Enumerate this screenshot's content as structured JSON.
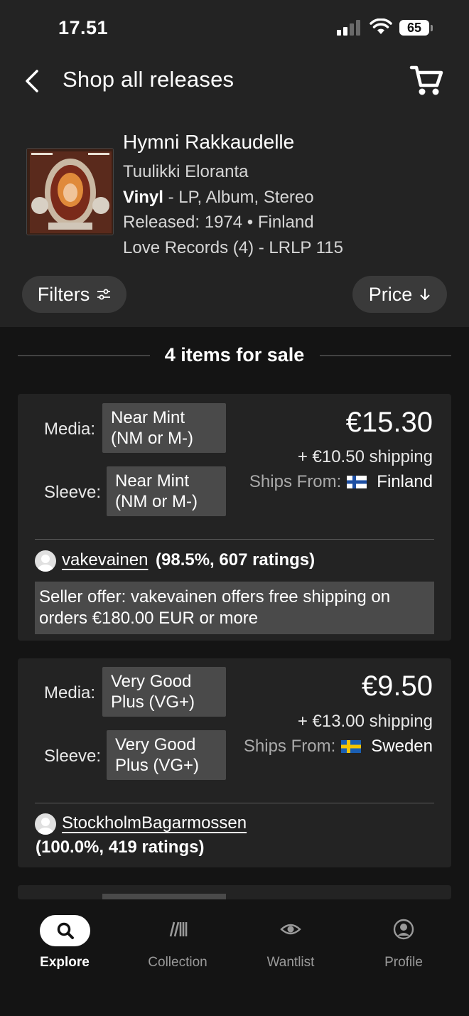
{
  "status_bar": {
    "time": "17.51",
    "battery": "65"
  },
  "header": {
    "title": "Shop all releases"
  },
  "release": {
    "title": "Hymni Rakkaudelle",
    "artist": "Tuulikki Eloranta",
    "format_bold": "Vinyl",
    "format_rest": " - LP, Album, Stereo",
    "released": "Released: 1974 • Finland",
    "label": "Love Records (4) - LRLP 115"
  },
  "controls": {
    "filters_label": "Filters",
    "price_label": "Price"
  },
  "sale_header": "4 items for sale",
  "listings": [
    {
      "media_label": "Media:",
      "media_value_1": "Near Mint",
      "media_value_2": "(NM or M-)",
      "sleeve_label": "Sleeve:",
      "sleeve_value_1": "Near Mint",
      "sleeve_value_2": "(NM or M-)",
      "price": "€15.30",
      "shipping": "+ €10.50 shipping",
      "ships_from_label": "Ships From:",
      "ships_from_country": "Finland",
      "seller_name": "vakevainen",
      "seller_rating": "(98.5%, 607 ratings)",
      "seller_offer": "Seller offer: vakevainen offers free shipping on orders €180.00 EUR or more"
    },
    {
      "media_label": "Media:",
      "media_value_1": "Very Good",
      "media_value_2": "Plus (VG+)",
      "sleeve_label": "Sleeve:",
      "sleeve_value_1": "Very Good",
      "sleeve_value_2": "Plus (VG+)",
      "price": "€9.50",
      "shipping": "+ €13.00 shipping",
      "ships_from_label": "Ships From:",
      "ships_from_country": "Sweden",
      "seller_name": "StockholmBagarmossen",
      "seller_rating": "(100.0%, 419 ratings)"
    }
  ],
  "tabs": [
    {
      "label": "Explore",
      "icon": "search-icon",
      "active": true
    },
    {
      "label": "Collection",
      "icon": "collection-icon",
      "active": false
    },
    {
      "label": "Wantlist",
      "icon": "eye-icon",
      "active": false
    },
    {
      "label": "Profile",
      "icon": "profile-icon",
      "active": false
    }
  ],
  "colors": {
    "background": "#141414",
    "panel": "#232323",
    "chip": "#4a4a4a",
    "pill": "#3a3a3a",
    "text": "#ffffff",
    "muted": "#9a9a9a"
  }
}
